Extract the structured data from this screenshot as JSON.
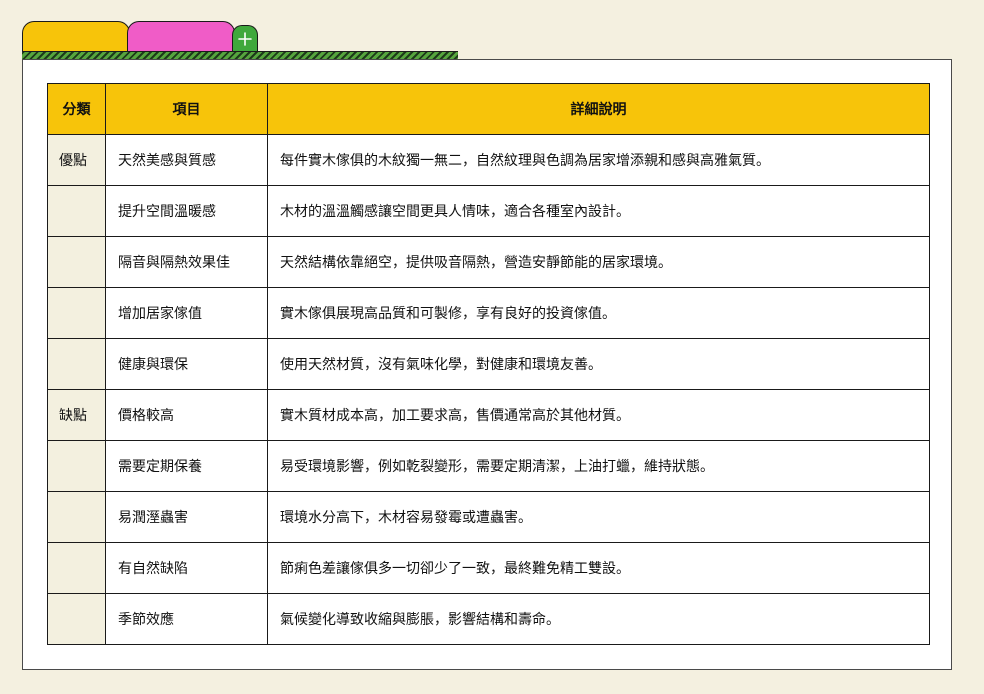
{
  "tabs": {
    "add_symbol": "+"
  },
  "table": {
    "headers": [
      "分類",
      "項目",
      "詳細說明"
    ],
    "rows": [
      {
        "category": "優點",
        "item": "天然美感與質感",
        "detail": "每件實木傢俱的木紋獨一無二，自然紋理與色調為居家增添親和感與高雅氣質。"
      },
      {
        "category": "",
        "item": "提升空間溫暖感",
        "detail": "木材的溫溫觸感讓空間更具人情味，適合各種室內設計。"
      },
      {
        "category": "",
        "item": "隔音與隔熱效果佳",
        "detail": "天然結構依靠絕空，提供吸音隔熱，營造安靜節能的居家環境。"
      },
      {
        "category": "",
        "item": "增加居家傢值",
        "detail": "實木傢俱展現高品質和可製修，享有良好的投資傢值。"
      },
      {
        "category": "",
        "item": "健康與環保",
        "detail": "使用天然材質，沒有氣味化學，對健康和環境友善。"
      },
      {
        "category": "缺點",
        "item": "價格較高",
        "detail": "實木質材成本高，加工要求高，售價通常高於其他材質。"
      },
      {
        "category": "",
        "item": "需要定期保養",
        "detail": "易受環境影響，例如乾裂變形，需要定期清潔，上油打蠟，維持狀態。"
      },
      {
        "category": "",
        "item": "易潤溼蟲害",
        "detail": "環境水分高下，木材容易發霉或遭蟲害。"
      },
      {
        "category": "",
        "item": "有自然缺陷",
        "detail": "節痢色差讓傢俱多一切卻少了一致，最終難免精工雙設。"
      },
      {
        "category": "",
        "item": "季節效應",
        "detail": "氣候變化導致收縮與膨脹，影響結構和壽命。"
      }
    ]
  },
  "colors": {
    "background": "#f4f0e0",
    "tab_yellow": "#f7c40a",
    "tab_pink": "#f05cc7",
    "tab_add_green": "#3fa83c",
    "header_fill": "#f7c40a",
    "category_fill": "#f3f0df"
  }
}
